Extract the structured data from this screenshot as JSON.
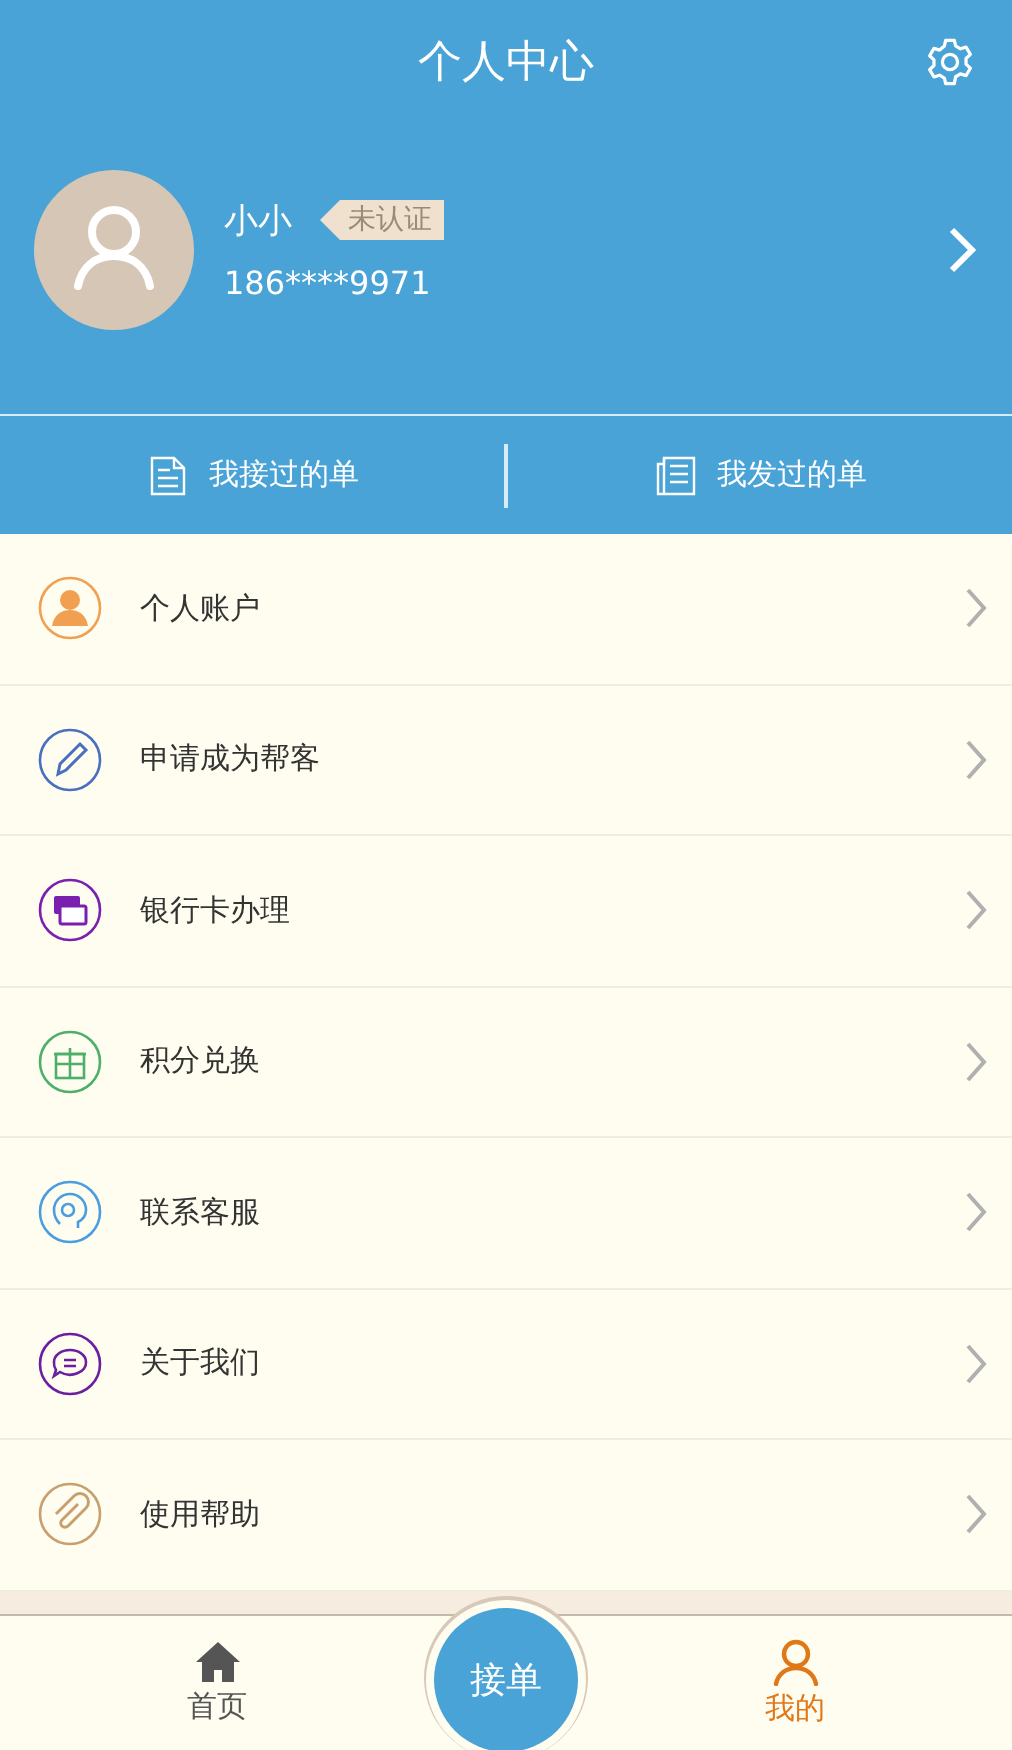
{
  "header": {
    "title": "个人中心"
  },
  "profile": {
    "name": "小小",
    "badge": "未认证",
    "phone": "186****9971"
  },
  "order_tabs": [
    {
      "label": "我接过的单",
      "kind": "received"
    },
    {
      "label": "我发过的单",
      "kind": "sent"
    }
  ],
  "menu": [
    {
      "label": "个人账户",
      "kind": "person",
      "color": "#f0a050"
    },
    {
      "label": "申请成为帮客",
      "kind": "pen",
      "color": "#4a6fc0"
    },
    {
      "label": "银行卡办理",
      "kind": "card",
      "color": "#7a1fb0"
    },
    {
      "label": "积分兑换",
      "kind": "gift",
      "color": "#4caf6a"
    },
    {
      "label": "联系客服",
      "kind": "service",
      "color": "#4a9ee0"
    },
    {
      "label": "关于我们",
      "kind": "chat",
      "color": "#6a1fa0"
    },
    {
      "label": "使用帮助",
      "kind": "clip",
      "color": "#c8a070"
    }
  ],
  "nav": [
    {
      "label": "首页",
      "kind": "home",
      "selected": false
    },
    {
      "label": "接单",
      "kind": "center",
      "selected": false
    },
    {
      "label": "我的",
      "kind": "me",
      "selected": true
    }
  ]
}
